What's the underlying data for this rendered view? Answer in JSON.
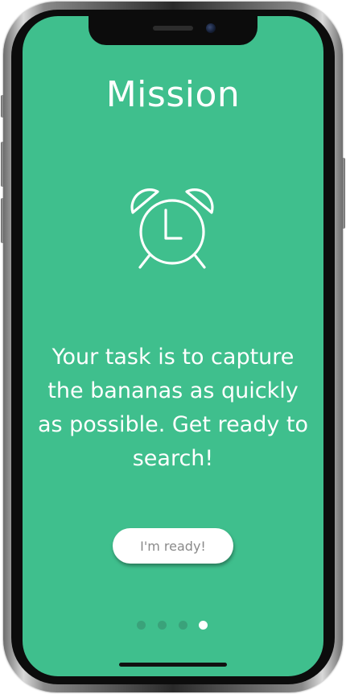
{
  "screen": {
    "title": "Mission",
    "icon": "alarm-clock-icon",
    "description": "Your task is to capture the bananas as quickly as possible. Get ready to search!",
    "button_label": "I'm ready!"
  },
  "pager": {
    "total": 4,
    "current": 4
  },
  "colors": {
    "background": "#3fbf8d",
    "inactive_dot": "#3aa27a",
    "active_dot": "#ffffff",
    "button_text": "#8a8a8a"
  }
}
